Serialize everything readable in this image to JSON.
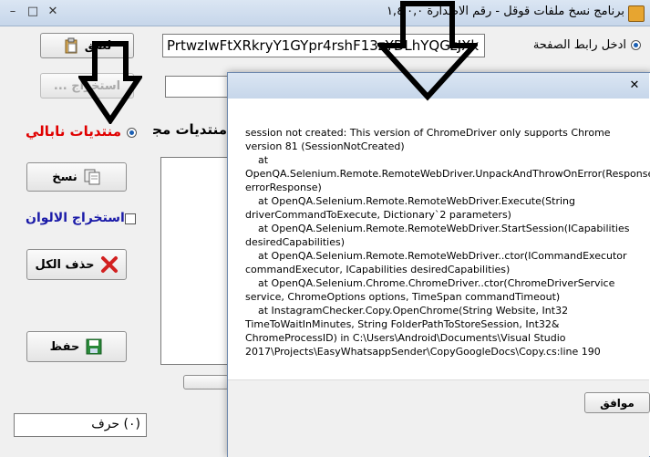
{
  "window": {
    "title": "برنامج نسخ ملفات قوقل - رقم الاصدارة ١,٤,٠,٠",
    "controls": {
      "minimize": "–",
      "maximize": "□",
      "close": "✕"
    }
  },
  "url_section": {
    "radio_label": "ادخل رابط الصفحة",
    "url_value": "PrtwzIwFtXRkryY1GYpr4rshF13zYDLhYQGzJXk",
    "paste_button": "لصق"
  },
  "extract_button": "استخراج ...",
  "source_options": {
    "nabali_label": "منتديات نابالي",
    "free_label": "منتديات مجانية"
  },
  "actions": {
    "copy_button": "نسخ",
    "extract_colors_label": "استخراج الالوان",
    "delete_all_button": "حذف الكل",
    "save_button": "حفظ"
  },
  "char_counter": "(٠) حرف",
  "dialog": {
    "message": "session not created: This version of ChromeDriver only supports Chrome version 81 (SessionNotCreated)\n    at OpenQA.Selenium.Remote.RemoteWebDriver.UnpackAndThrowOnError(Response errorResponse)\n    at OpenQA.Selenium.Remote.RemoteWebDriver.Execute(String driverCommandToExecute, Dictionary`2 parameters)\n    at OpenQA.Selenium.Remote.RemoteWebDriver.StartSession(ICapabilities desiredCapabilities)\n    at OpenQA.Selenium.Remote.RemoteWebDriver..ctor(ICommandExecutor commandExecutor, ICapabilities desiredCapabilities)\n    at OpenQA.Selenium.Chrome.ChromeDriver..ctor(ChromeDriverService service, ChromeOptions options, TimeSpan commandTimeout)\n    at InstagramChecker.Copy.OpenChrome(String Website, Int32 TimeToWaitInMinutes, String FolderPathToStoreSession, Int32& ChromeProcessID) in C:\\Users\\Android\\Documents\\Visual Studio 2017\\Projects\\EasyWhatsappSender\\CopyGoogleDocs\\Copy.cs:line 190",
    "ok_button": "موافق",
    "close": "✕"
  },
  "colors": {
    "nabali_red": "#e00000",
    "extract_colors_blue": "#1a1aa8",
    "delete_red": "#d22020",
    "save_green": "#2a8a3a"
  }
}
